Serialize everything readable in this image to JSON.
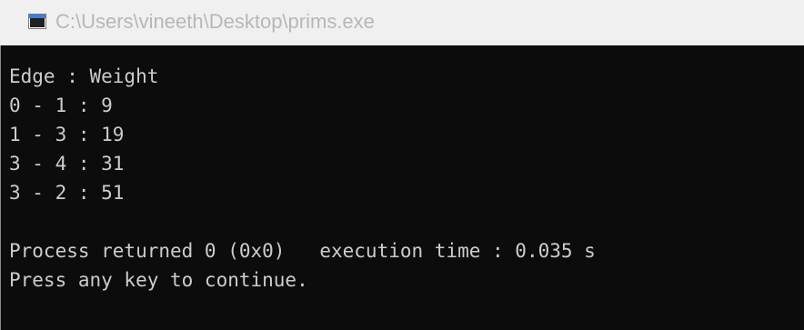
{
  "window": {
    "title": "C:\\Users\\vineeth\\Desktop\\prims.exe",
    "icon": "console-window-icon"
  },
  "console": {
    "lines": [
      "Edge : Weight",
      "0 - 1 : 9",
      "1 - 3 : 19",
      "3 - 4 : 31",
      "3 - 2 : 51",
      "",
      "Process returned 0 (0x0)   execution time : 0.035 s",
      "Press any key to continue."
    ]
  },
  "colors": {
    "background": "#0c0c0c",
    "text": "#cccccc",
    "titlebar": "#f0f0f0",
    "title_text": "#b7b7b7"
  }
}
